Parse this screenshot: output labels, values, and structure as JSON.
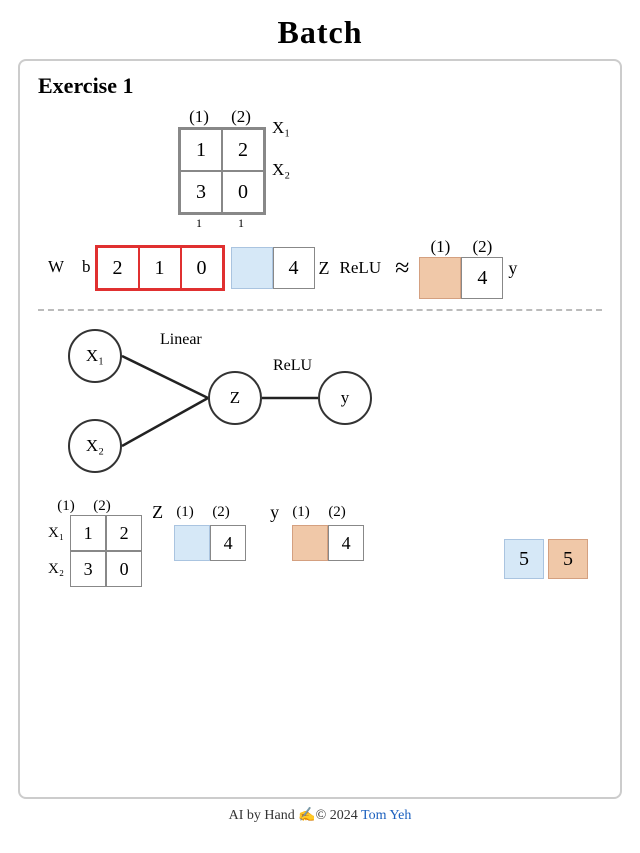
{
  "title": "Batch",
  "exercise": "Exercise 1",
  "col_labels": [
    "(1)",
    "(2)"
  ],
  "input_matrix": [
    [
      1,
      2
    ],
    [
      3,
      0
    ]
  ],
  "row_labels_x": [
    "X₁",
    "X₂"
  ],
  "subscripts": [
    "1",
    "1"
  ],
  "w_label": "W",
  "b_label": "b",
  "w_values": [
    2,
    1,
    0
  ],
  "b_value": "",
  "b_number": 4,
  "z_label": "Z",
  "relu_label": "ReLU",
  "approx": "≈",
  "y_col_labels": [
    "(1)",
    "(2)"
  ],
  "y_value": 4,
  "y_label": "y",
  "nn": {
    "x1_label": "X₁",
    "x2_label": "X₂",
    "z_label": "Z",
    "y_label": "y",
    "linear_label": "Linear",
    "relu_label": "ReLU"
  },
  "bottom": {
    "x_col_labels": [
      "(1)",
      "(2)"
    ],
    "x_row_labels": [
      "X₁",
      "X₂"
    ],
    "x_matrix": [
      [
        1,
        2
      ],
      [
        3,
        0
      ]
    ],
    "z_col_labels": [
      "(1)",
      "(2)"
    ],
    "z_value": 4,
    "z_var": "Z",
    "y_col_labels": [
      "(1)",
      "(2)"
    ],
    "y_value": 4,
    "y_var": "y"
  },
  "result_boxes": [
    5,
    5
  ],
  "footer": {
    "text": "AI by Hand ✍© 2024 ",
    "link_text": "Tom Yeh",
    "link_url": "#"
  }
}
